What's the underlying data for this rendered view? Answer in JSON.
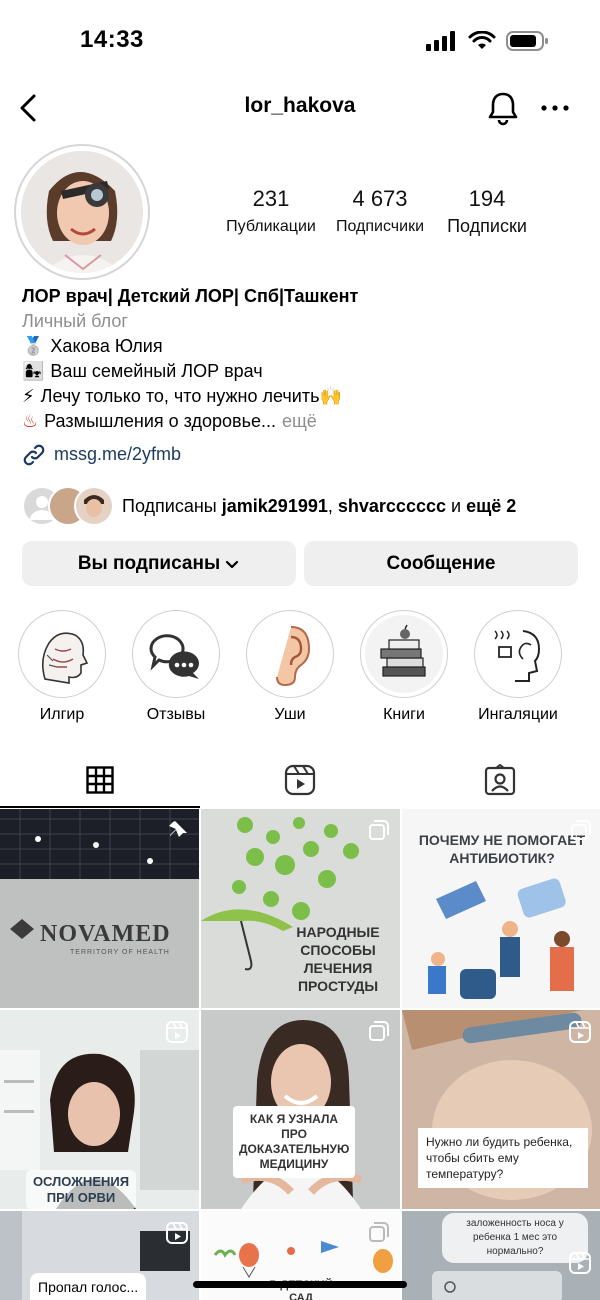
{
  "status_bar": {
    "time": "14:33"
  },
  "header": {
    "username": "lor_hakova"
  },
  "profile": {
    "stats": [
      {
        "value": "231",
        "label": "Публикации"
      },
      {
        "value": "4 673",
        "label": "Подписчики"
      },
      {
        "value": "194",
        "label": "Подписки"
      }
    ],
    "bio": {
      "name": "ЛОР врач| Детский ЛОР| Спб|Ташкент",
      "category": "Личный блог",
      "lines": [
        {
          "emoji": "🥈",
          "text": "Хакова Юлия"
        },
        {
          "emoji": "👩‍👧",
          "text": "Ваш семейный ЛОР врач"
        },
        {
          "emoji": "⚡",
          "text": "Лечу только то, что нужно лечить🙌"
        },
        {
          "emoji": "♨",
          "text": "Размышления о здоровье...",
          "more": "ещё"
        }
      ],
      "link": "mssg.me/2yfmb"
    },
    "followed_by": {
      "prefix": "Подписаны",
      "user1": "jamik291991",
      "separator": ",",
      "user2": "shvarcccccc",
      "conj": "и",
      "more": "ещё 2"
    }
  },
  "actions": {
    "following_label": "Вы подписаны",
    "message_label": "Сообщение"
  },
  "highlights": [
    {
      "label": "Илгир",
      "icon": "anatomy-head-icon"
    },
    {
      "label": "Отзывы",
      "icon": "chat-bubbles-icon"
    },
    {
      "label": "Уши",
      "icon": "ear-icon"
    },
    {
      "label": "Книги",
      "icon": "books-icon"
    },
    {
      "label": "Ингаляции",
      "icon": "inhalation-icon"
    }
  ],
  "tabs": [
    {
      "name": "posts-grid",
      "icon": "grid-icon",
      "active": true
    },
    {
      "name": "reels",
      "icon": "reels-icon",
      "active": false
    },
    {
      "name": "tagged",
      "icon": "tagged-icon",
      "active": false
    }
  ],
  "posts": [
    {
      "text": "NOVAMED",
      "subtext": "TERRITORY OF HEALTH",
      "badge": "pin-icon"
    },
    {
      "text": "НАРОДНЫЕ СПОСОБЫ ЛЕЧЕНИЯ ПРОСТУДЫ",
      "badge": "carousel-icon"
    },
    {
      "text": "ПОЧЕМУ НЕ ПОМОГАЕТ АНТИБИОТИК?",
      "badge": "carousel-icon"
    },
    {
      "text": "ОСЛОЖНЕНИЯ ПРИ ОРВИ",
      "badge": "reel-icon"
    },
    {
      "text": "КАК Я УЗНАЛА ПРО ДОКАЗАТЕЛЬНУЮ МЕДИЦИНУ",
      "badge": "carousel-icon"
    },
    {
      "text": "Нужно ли будить ребенка, чтобы сбить ему температуру?",
      "badge": "reel-icon"
    },
    {
      "text": "Пропал голос...",
      "badge": "reel-icon"
    },
    {
      "text": "В ДЕТСКИЙ САД",
      "badge": "carousel-icon"
    },
    {
      "text": "заложенность носа у ребенка 1 мес это нормально?",
      "badge": "reel-icon"
    }
  ],
  "colors": {
    "link": "#1a3a5e",
    "button_bg": "#efefef",
    "muted": "#8e8e8e"
  }
}
